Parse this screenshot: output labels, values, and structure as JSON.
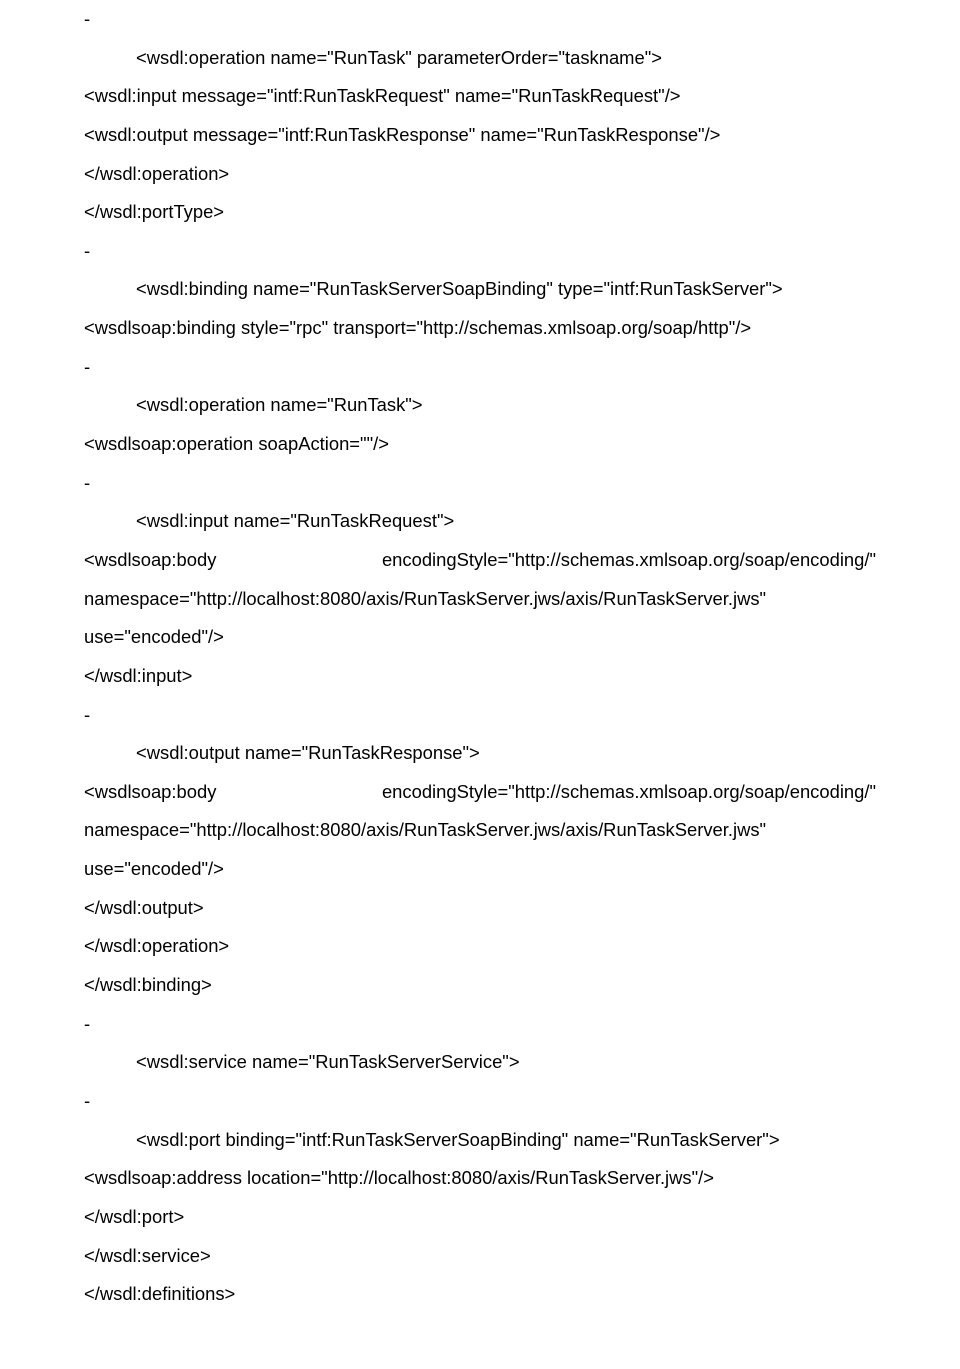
{
  "lines": {
    "l1": "-",
    "l2": "<wsdl:operation name=\"RunTask\" parameterOrder=\"taskname\">",
    "l3": "<wsdl:input message=\"intf:RunTaskRequest\" name=\"RunTaskRequest\"/>",
    "l4": "<wsdl:output message=\"intf:RunTaskResponse\" name=\"RunTaskResponse\"/>",
    "l5": "</wsdl:operation>",
    "l6": "</wsdl:portType>",
    "l7": "-",
    "l8": "<wsdl:binding name=\"RunTaskServerSoapBinding\" type=\"intf:RunTaskServer\">",
    "l9": "<wsdlsoap:binding style=\"rpc\" transport=\"http://schemas.xmlsoap.org/soap/http\"/>",
    "l10": "-",
    "l11": "<wsdl:operation name=\"RunTask\">",
    "l12": "<wsdlsoap:operation soapAction=\"\"/>",
    "l13": "-",
    "l14": "<wsdl:input name=\"RunTaskRequest\">",
    "l15a": "<wsdlsoap:body",
    "l15b": "encodingStyle=\"http://schemas.xmlsoap.org/soap/encoding/\"",
    "l16": "namespace=\"http://localhost:8080/axis/RunTaskServer.jws/axis/RunTaskServer.jws\"",
    "l17": "use=\"encoded\"/>",
    "l18": "</wsdl:input>",
    "l19": "-",
    "l20": "<wsdl:output name=\"RunTaskResponse\">",
    "l21a": "<wsdlsoap:body",
    "l21b": "encodingStyle=\"http://schemas.xmlsoap.org/soap/encoding/\"",
    "l22": "namespace=\"http://localhost:8080/axis/RunTaskServer.jws/axis/RunTaskServer.jws\"",
    "l23": "use=\"encoded\"/>",
    "l24": "</wsdl:output>",
    "l25": "</wsdl:operation>",
    "l26": "</wsdl:binding>",
    "l27": "-",
    "l28": "<wsdl:service name=\"RunTaskServerService\">",
    "l29": "-",
    "l30": "<wsdl:port binding=\"intf:RunTaskServerSoapBinding\" name=\"RunTaskServer\">",
    "l31": "<wsdlsoap:address location=\"http://localhost:8080/axis/RunTaskServer.jws\"/>",
    "l32": "</wsdl:port>",
    "l33": "</wsdl:service>",
    "l34": "</wsdl:definitions>"
  }
}
